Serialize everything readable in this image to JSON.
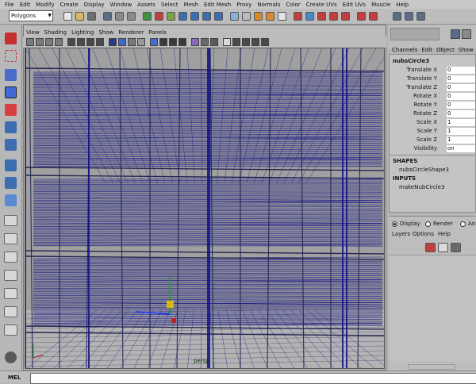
{
  "menubar": {
    "items": [
      "File",
      "Edit",
      "Modify",
      "Create",
      "Display",
      "Window",
      "Assets",
      "Select",
      "Mesh",
      "Edit Mesh",
      "Proxy",
      "Normals",
      "Color",
      "Create UVs",
      "Edit UVs",
      "Muscle",
      "Help"
    ]
  },
  "statusline": {
    "mode": "Polygons"
  },
  "viewport": {
    "menu": [
      "View",
      "Shading",
      "Lighting",
      "Show",
      "Renderer",
      "Panels"
    ],
    "camera_label": "persp"
  },
  "channel_box": {
    "menu": [
      "Channels",
      "Edit",
      "Object",
      "Show"
    ],
    "object_name": "nubsCircle3",
    "attributes": [
      {
        "label": "Translate X",
        "value": "0"
      },
      {
        "label": "Translate Y",
        "value": "0"
      },
      {
        "label": "Translate Z",
        "value": "0"
      },
      {
        "label": "Rotate X",
        "value": "0"
      },
      {
        "label": "Rotate Y",
        "value": "0"
      },
      {
        "label": "Rotate Z",
        "value": "0"
      },
      {
        "label": "Scale X",
        "value": "1"
      },
      {
        "label": "Scale Y",
        "value": "1"
      },
      {
        "label": "Scale Z",
        "value": "1"
      },
      {
        "label": "Visibility",
        "value": "on"
      }
    ],
    "shapes_header": "SHAPES",
    "shape_name": "nubsCircleShape3",
    "inputs_header": "INPUTS",
    "input_name": "makeNubCircle3"
  },
  "layer_editor": {
    "modes": [
      "Display",
      "Render",
      "Ani"
    ],
    "menu": [
      "Layers",
      "Options",
      "Help"
    ]
  },
  "command_line": {
    "label": "MEL"
  },
  "colors": {
    "wire": "#16168a",
    "grid_dark": "#202050",
    "viewport_bg": "#a0a0a0"
  }
}
